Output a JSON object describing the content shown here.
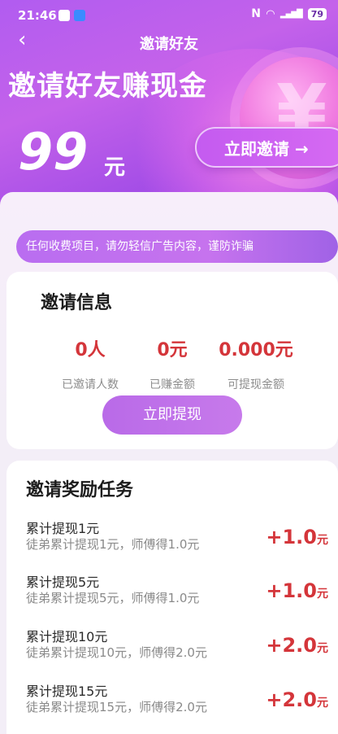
{
  "status_bar": {
    "time": "21:46",
    "battery": "79"
  },
  "nav": {
    "back_glyph": "‹",
    "title": "邀请好友"
  },
  "hero": {
    "headline": "邀请好友赚现金",
    "amount": "99",
    "unit": "元",
    "invite_button": "立即邀请 →"
  },
  "notice": {
    "text": "任何收费项目，请勿轻信广告内容，谨防诈骗"
  },
  "invite_info": {
    "title": "邀请信息",
    "stats": [
      {
        "value": "0人",
        "label": "已邀请人数"
      },
      {
        "value": "0元",
        "label": "已赚金额"
      },
      {
        "value": "0.000元",
        "label": "可提现金额"
      }
    ],
    "withdraw_button": "立即提现"
  },
  "tasks": {
    "title": "邀请奖励任务",
    "items": [
      {
        "name": "累计提现1元",
        "desc": "徒弟累计提现1元，师傅得1.0元",
        "reward": "+1.0",
        "unit": "元"
      },
      {
        "name": "累计提现5元",
        "desc": "徒弟累计提现5元，师傅得1.0元",
        "reward": "+1.0",
        "unit": "元"
      },
      {
        "name": "累计提现10元",
        "desc": "徒弟累计提现10元，师傅得2.0元",
        "reward": "+2.0",
        "unit": "元"
      },
      {
        "name": "累计提现15元",
        "desc": "徒弟累计提现15元，师傅得2.0元",
        "reward": "+2.0",
        "unit": "元"
      }
    ]
  },
  "colors": {
    "accent": "#b15cf0",
    "reward_red": "#d4353a"
  }
}
